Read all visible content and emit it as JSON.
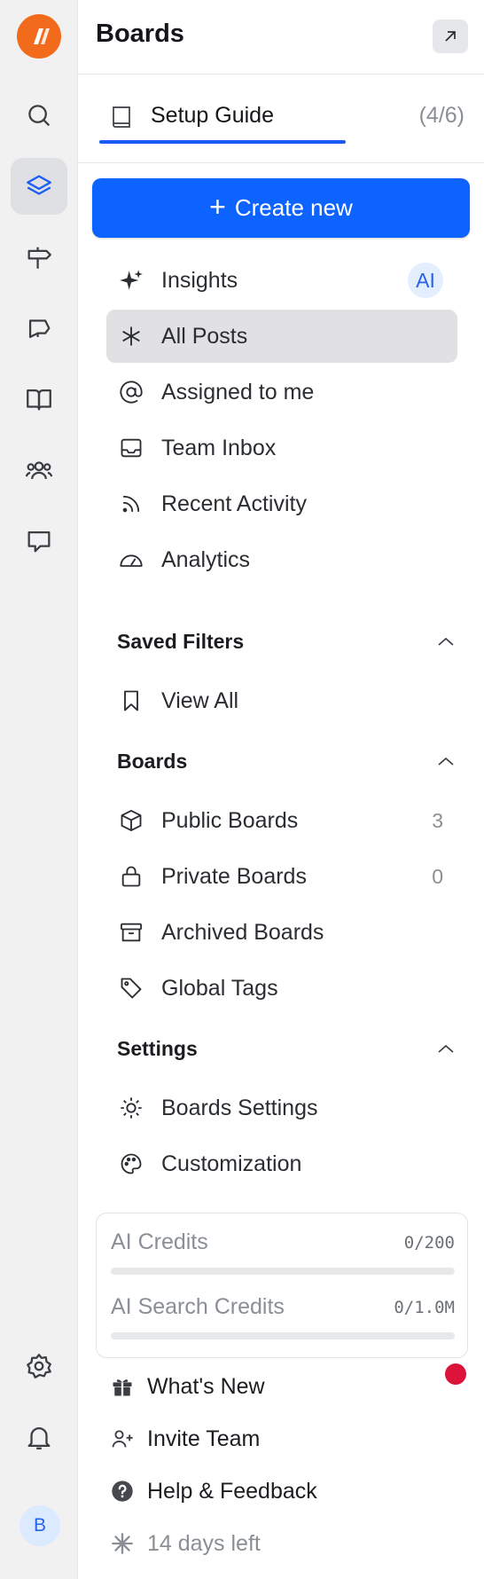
{
  "header": {
    "title": "Boards"
  },
  "setup_guide": {
    "label": "Setup Guide",
    "progress": "(4/6)",
    "completed": 4,
    "total": 6
  },
  "create_button": {
    "label": "Create new"
  },
  "nav": [
    {
      "label": "Insights",
      "icon": "sparkles-icon",
      "badge": "AI"
    },
    {
      "label": "All Posts",
      "icon": "asterisk-icon",
      "active": true
    },
    {
      "label": "Assigned to me",
      "icon": "at-sign-icon"
    },
    {
      "label": "Team Inbox",
      "icon": "inbox-icon"
    },
    {
      "label": "Recent Activity",
      "icon": "rss-icon"
    },
    {
      "label": "Analytics",
      "icon": "gauge-icon"
    }
  ],
  "saved_filters": {
    "title": "Saved Filters",
    "items": [
      {
        "label": "View All",
        "icon": "bookmark-icon"
      }
    ]
  },
  "boards": {
    "title": "Boards",
    "items": [
      {
        "label": "Public Boards",
        "icon": "cube-icon",
        "count": "3"
      },
      {
        "label": "Private Boards",
        "icon": "lock-icon",
        "count": "0"
      },
      {
        "label": "Archived Boards",
        "icon": "archive-icon"
      },
      {
        "label": "Global Tags",
        "icon": "tag-icon"
      }
    ]
  },
  "settings": {
    "title": "Settings",
    "items": [
      {
        "label": "Boards Settings",
        "icon": "gear-icon"
      },
      {
        "label": "Customization",
        "icon": "palette-icon"
      }
    ]
  },
  "credits": [
    {
      "label": "AI Credits",
      "value": "0/200",
      "used_fraction": 0
    },
    {
      "label": "AI Search Credits",
      "value": "0/1.0M",
      "used_fraction": 0
    }
  ],
  "footer": [
    {
      "label": "What's New",
      "icon": "gift-icon"
    },
    {
      "label": "Invite Team",
      "icon": "user-plus-icon"
    },
    {
      "label": "Help & Feedback",
      "icon": "help-icon"
    },
    {
      "label": "14 days left",
      "icon": "asterisk-icon"
    }
  ],
  "rail": {
    "avatar_initial": "B"
  },
  "colors": {
    "accent": "#0d63ff",
    "logo": "#f26a1b",
    "notification": "#dc143c"
  }
}
